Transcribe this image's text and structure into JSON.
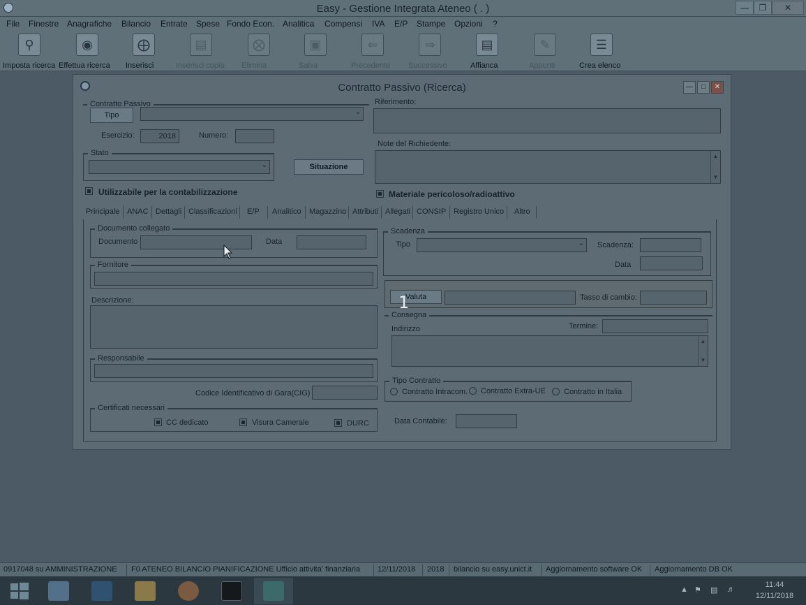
{
  "window": {
    "title": "Easy - Gestione Integrata Ateneo ( . )"
  },
  "menu": [
    "File",
    "Finestre",
    "Anagrafiche",
    "Bilancio",
    "Entrate",
    "Spese",
    "Fondo Econ.",
    "Analitica",
    "Compensi",
    "IVA",
    "E/P",
    "Stampe",
    "Opzioni",
    "?"
  ],
  "toolbar": [
    {
      "label": "Imposta ricerca",
      "icon": "magnifier-icon"
    },
    {
      "label": "Effettua ricerca",
      "icon": "binoculars-icon"
    },
    {
      "label": "Inserisci",
      "icon": "plus-icon"
    },
    {
      "label": "Inserisci copia",
      "icon": "copy-icon"
    },
    {
      "label": "Elimina",
      "icon": "delete-icon"
    },
    {
      "label": "Salva",
      "icon": "floppy-icon"
    },
    {
      "label": "Precedente",
      "icon": "arrow-left-icon"
    },
    {
      "label": "Successivo",
      "icon": "arrow-right-icon"
    },
    {
      "label": "Affianca",
      "icon": "tile-windows-icon"
    },
    {
      "label": "Appunti",
      "icon": "notes-icon"
    },
    {
      "label": "Crea elenco",
      "icon": "list-icon"
    }
  ],
  "dialog": {
    "title": "Contratto Passivo (Ricerca)",
    "contratto_group": "Contratto Passivo",
    "tipo_button": "Tipo",
    "esercizio_label": "Esercizio:",
    "esercizio_value": "2018",
    "numero_label": "Numero:",
    "stato_group": "Stato",
    "situazione_button": "Situazione",
    "utilizzabile_label": "Utilizzabile per la contabilizzazione",
    "riferimento_label": "Riferimento:",
    "note_label": "Note del Richiedente:",
    "materiale_label": "Materiale pericoloso/radioattivo",
    "tabs": [
      "Principale",
      "ANAC",
      "Dettagli",
      "Classificazioni",
      "E/P",
      "Analitico",
      "Magazzino",
      "Attributi",
      "Allegati",
      "CONSIP",
      "Registro Unico",
      "Altro"
    ],
    "documento_group": "Documento collegato",
    "documento_label": "Documento",
    "data_label": "Data",
    "fornitore_group": "Fornitore",
    "descrizione_label": "Descrizione:",
    "responsabile_group": "Responsabile",
    "cig_label": "Codice Identificativo di Gara(CIG)",
    "certificati_group": "Certificati necessari",
    "cc_dedicato": "CC dedicato",
    "visura": "Visura Camerale",
    "durc": "DURC",
    "scadenza_group": "Scadenza",
    "tipo_label": "Tipo",
    "scadenza_label": "Scadenza:",
    "data2_label": "Data",
    "valuta_button": "Valuta",
    "tasso_label": "Tasso di cambio:",
    "consegna_group": "Consegna",
    "indirizzo_label": "Indirizzo",
    "termine_label": "Termine:",
    "tipo_contratto_group": "Tipo Contratto",
    "radio_intracom": "Contratto Intracom.",
    "radio_extra": "Contratto Extra-UE",
    "radio_italia": "Contratto in Italia",
    "data_contabile_label": "Data Contabile:"
  },
  "overlay_number": "1",
  "status": [
    "0917048 su AMMINISTRAZIONE",
    "F0 ATENEO BILANCIO PIANIFICAZIONE Ufficio attivita' finanziaria",
    "12/11/2018",
    "2018",
    "bilancio su easy.unict.it",
    "Aggiornamento software OK",
    "Aggiornamento DB OK"
  ],
  "taskbar": {
    "time": "11:44",
    "date": "12/11/2018"
  }
}
